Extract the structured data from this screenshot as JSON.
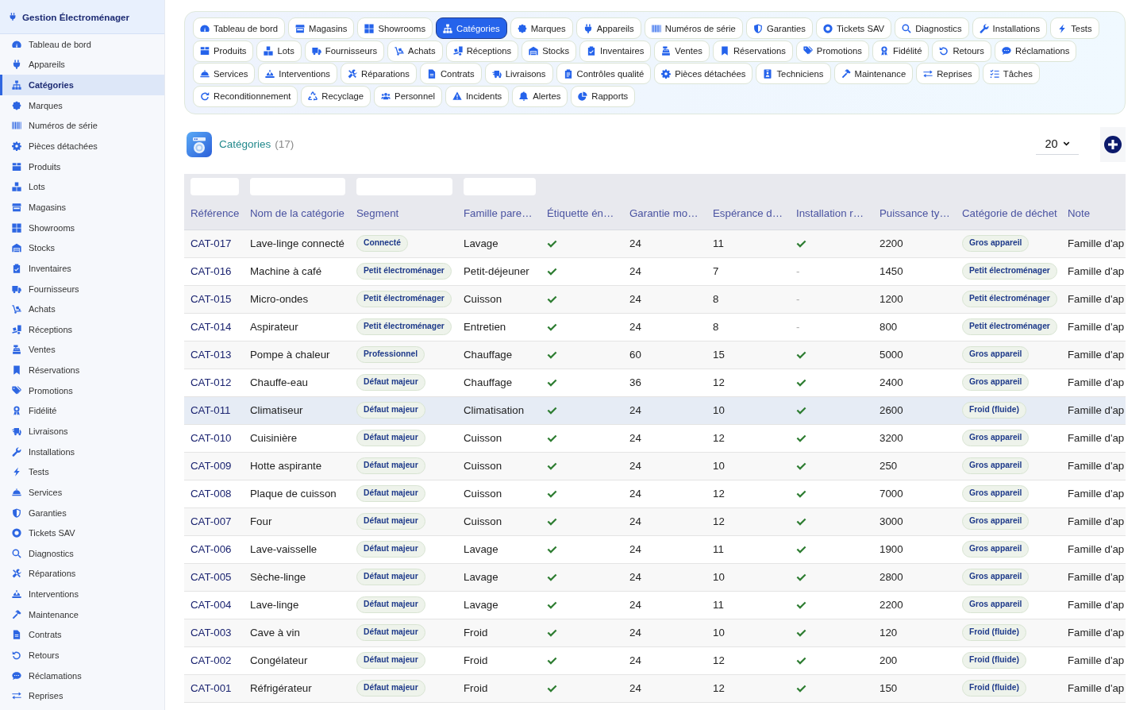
{
  "sidebar": {
    "title": "Gestion Électroménager",
    "items": [
      {
        "label": "Tableau de bord",
        "selected": false
      },
      {
        "label": "Appareils",
        "selected": false
      },
      {
        "label": "Catégories",
        "selected": true
      },
      {
        "label": "Marques",
        "selected": false
      },
      {
        "label": "Numéros de série",
        "selected": false
      },
      {
        "label": "Pièces détachées",
        "selected": false
      },
      {
        "label": "Produits",
        "selected": false
      },
      {
        "label": "Lots",
        "selected": false
      },
      {
        "label": "Magasins",
        "selected": false
      },
      {
        "label": "Showrooms",
        "selected": false
      },
      {
        "label": "Stocks",
        "selected": false
      },
      {
        "label": "Inventaires",
        "selected": false
      },
      {
        "label": "Fournisseurs",
        "selected": false
      },
      {
        "label": "Achats",
        "selected": false
      },
      {
        "label": "Réceptions",
        "selected": false
      },
      {
        "label": "Ventes",
        "selected": false
      },
      {
        "label": "Réservations",
        "selected": false
      },
      {
        "label": "Promotions",
        "selected": false
      },
      {
        "label": "Fidélité",
        "selected": false
      },
      {
        "label": "Livraisons",
        "selected": false
      },
      {
        "label": "Installations",
        "selected": false
      },
      {
        "label": "Tests",
        "selected": false
      },
      {
        "label": "Services",
        "selected": false
      },
      {
        "label": "Garanties",
        "selected": false
      },
      {
        "label": "Tickets SAV",
        "selected": false
      },
      {
        "label": "Diagnostics",
        "selected": false
      },
      {
        "label": "Réparations",
        "selected": false
      },
      {
        "label": "Interventions",
        "selected": false
      },
      {
        "label": "Maintenance",
        "selected": false
      },
      {
        "label": "Contrats",
        "selected": false
      },
      {
        "label": "Retours",
        "selected": false
      },
      {
        "label": "Réclamations",
        "selected": false
      },
      {
        "label": "Reprises",
        "selected": false
      }
    ]
  },
  "tab_rows": [
    [
      {
        "label": "Tableau de bord",
        "selected": false
      },
      {
        "label": "Magasins",
        "selected": false
      },
      {
        "label": "Showrooms",
        "selected": false
      },
      {
        "label": "Catégories",
        "selected": true
      },
      {
        "label": "Marques",
        "selected": false
      },
      {
        "label": "Appareils",
        "selected": false
      },
      {
        "label": "Numéros de série",
        "selected": false
      },
      {
        "label": "Garanties",
        "selected": false
      },
      {
        "label": "Tickets SAV",
        "selected": false
      },
      {
        "label": "Diagnostics",
        "selected": false
      },
      {
        "label": "Installations",
        "selected": false
      },
      {
        "label": "Tests",
        "selected": false
      }
    ],
    [
      {
        "label": "Produits",
        "selected": false
      },
      {
        "label": "Lots",
        "selected": false
      },
      {
        "label": "Fournisseurs",
        "selected": false
      },
      {
        "label": "Achats",
        "selected": false
      },
      {
        "label": "Réceptions",
        "selected": false
      },
      {
        "label": "Stocks",
        "selected": false
      },
      {
        "label": "Inventaires",
        "selected": false
      },
      {
        "label": "Ventes",
        "selected": false
      },
      {
        "label": "Réservations",
        "selected": false
      },
      {
        "label": "Promotions",
        "selected": false
      },
      {
        "label": "Fidélité",
        "selected": false
      },
      {
        "label": "Retours",
        "selected": false
      },
      {
        "label": "Réclamations",
        "selected": false
      }
    ],
    [
      {
        "label": "Services",
        "selected": false
      },
      {
        "label": "Interventions",
        "selected": false
      },
      {
        "label": "Réparations",
        "selected": false
      },
      {
        "label": "Contrats",
        "selected": false
      },
      {
        "label": "Livraisons",
        "selected": false
      },
      {
        "label": "Contrôles qualité",
        "selected": false
      },
      {
        "label": "Pièces détachées",
        "selected": false
      },
      {
        "label": "Techniciens",
        "selected": false
      },
      {
        "label": "Maintenance",
        "selected": false
      },
      {
        "label": "Reprises",
        "selected": false
      },
      {
        "label": "Tâches",
        "selected": false
      }
    ],
    [
      {
        "label": "Reconditionnement",
        "selected": false
      },
      {
        "label": "Recyclage",
        "selected": false
      },
      {
        "label": "Personnel",
        "selected": false
      },
      {
        "label": "Incidents",
        "selected": false
      },
      {
        "label": "Alertes",
        "selected": false
      },
      {
        "label": "Rapports",
        "selected": false
      }
    ]
  ],
  "page_header": {
    "title": "Catégories",
    "count": "(17)",
    "page_size": "20"
  },
  "table": {
    "columns": [
      {
        "label": "Référence",
        "filter": true
      },
      {
        "label": "Nom de la catégorie",
        "filter": true
      },
      {
        "label": "Segment",
        "filter": true
      },
      {
        "label": "Famille pare…",
        "filter": true
      },
      {
        "label": "Étiquette én…",
        "filter": false
      },
      {
        "label": "Garantie mo…",
        "filter": false
      },
      {
        "label": "Espérance d…",
        "filter": false
      },
      {
        "label": "Installation r…",
        "filter": false
      },
      {
        "label": "Puissance ty…",
        "filter": false
      },
      {
        "label": "Catégorie de déchet",
        "filter": false
      },
      {
        "label": "Note",
        "filter": false
      }
    ],
    "rows": [
      {
        "reference": "CAT-017",
        "name": "Lave-linge connecté",
        "segment": "Connecté",
        "family": "Lavage",
        "energy_label": true,
        "warranty": "24",
        "lifespan": "11",
        "installation_required": true,
        "power": "2200",
        "waste_category": "Gros appareil",
        "note": "Famille d'ap",
        "selected": false
      },
      {
        "reference": "CAT-016",
        "name": "Machine à café",
        "segment": "Petit électroménager",
        "family": "Petit-déjeuner",
        "energy_label": true,
        "warranty": "24",
        "lifespan": "7",
        "installation_required": false,
        "empty_mark": "-",
        "power": "1450",
        "waste_category": "Petit électroménager",
        "note": "Famille d'ap",
        "selected": false
      },
      {
        "reference": "CAT-015",
        "name": "Micro-ondes",
        "segment": "Petit électroménager",
        "family": "Cuisson",
        "energy_label": true,
        "warranty": "24",
        "lifespan": "8",
        "installation_required": false,
        "empty_mark": "-",
        "power": "1200",
        "waste_category": "Petit électroménager",
        "note": "Famille d'ap",
        "selected": false
      },
      {
        "reference": "CAT-014",
        "name": "Aspirateur",
        "segment": "Petit électroménager",
        "family": "Entretien",
        "energy_label": true,
        "warranty": "24",
        "lifespan": "8",
        "installation_required": false,
        "empty_mark": "-",
        "power": "800",
        "waste_category": "Petit électroménager",
        "note": "Famille d'ap",
        "selected": false
      },
      {
        "reference": "CAT-013",
        "name": "Pompe à chaleur",
        "segment": "Professionnel",
        "family": "Chauffage",
        "energy_label": true,
        "warranty": "60",
        "lifespan": "15",
        "installation_required": true,
        "power": "5000",
        "waste_category": "Gros appareil",
        "note": "Famille d'ap",
        "selected": false
      },
      {
        "reference": "CAT-012",
        "name": "Chauffe-eau",
        "segment": "Défaut majeur",
        "family": "Chauffage",
        "energy_label": true,
        "warranty": "36",
        "lifespan": "12",
        "installation_required": true,
        "power": "2400",
        "waste_category": "Gros appareil",
        "note": "Famille d'ap",
        "selected": false
      },
      {
        "reference": "CAT-011",
        "name": "Climatiseur",
        "segment": "Défaut majeur",
        "family": "Climatisation",
        "energy_label": true,
        "warranty": "24",
        "lifespan": "10",
        "installation_required": true,
        "power": "2600",
        "waste_category": "Froid (fluide)",
        "note": "Famille d'ap",
        "selected": true
      },
      {
        "reference": "CAT-010",
        "name": "Cuisinière",
        "segment": "Défaut majeur",
        "family": "Cuisson",
        "energy_label": true,
        "warranty": "24",
        "lifespan": "12",
        "installation_required": true,
        "power": "3200",
        "waste_category": "Gros appareil",
        "note": "Famille d'ap",
        "selected": false
      },
      {
        "reference": "CAT-009",
        "name": "Hotte aspirante",
        "segment": "Défaut majeur",
        "family": "Cuisson",
        "energy_label": true,
        "warranty": "24",
        "lifespan": "10",
        "installation_required": true,
        "power": "250",
        "waste_category": "Gros appareil",
        "note": "Famille d'ap",
        "selected": false
      },
      {
        "reference": "CAT-008",
        "name": "Plaque de cuisson",
        "segment": "Défaut majeur",
        "family": "Cuisson",
        "energy_label": true,
        "warranty": "24",
        "lifespan": "12",
        "installation_required": true,
        "power": "7000",
        "waste_category": "Gros appareil",
        "note": "Famille d'ap",
        "selected": false
      },
      {
        "reference": "CAT-007",
        "name": "Four",
        "segment": "Défaut majeur",
        "family": "Cuisson",
        "energy_label": true,
        "warranty": "24",
        "lifespan": "12",
        "installation_required": true,
        "power": "3000",
        "waste_category": "Gros appareil",
        "note": "Famille d'ap",
        "selected": false
      },
      {
        "reference": "CAT-006",
        "name": "Lave-vaisselle",
        "segment": "Défaut majeur",
        "family": "Lavage",
        "energy_label": true,
        "warranty": "24",
        "lifespan": "11",
        "installation_required": true,
        "power": "1900",
        "waste_category": "Gros appareil",
        "note": "Famille d'ap",
        "selected": false
      },
      {
        "reference": "CAT-005",
        "name": "Sèche-linge",
        "segment": "Défaut majeur",
        "family": "Lavage",
        "energy_label": true,
        "warranty": "24",
        "lifespan": "10",
        "installation_required": true,
        "power": "2800",
        "waste_category": "Gros appareil",
        "note": "Famille d'ap",
        "selected": false
      },
      {
        "reference": "CAT-004",
        "name": "Lave-linge",
        "segment": "Défaut majeur",
        "family": "Lavage",
        "energy_label": true,
        "warranty": "24",
        "lifespan": "11",
        "installation_required": true,
        "power": "2200",
        "waste_category": "Gros appareil",
        "note": "Famille d'ap",
        "selected": false
      },
      {
        "reference": "CAT-003",
        "name": "Cave à vin",
        "segment": "Défaut majeur",
        "family": "Froid",
        "energy_label": true,
        "warranty": "24",
        "lifespan": "10",
        "installation_required": true,
        "power": "120",
        "waste_category": "Froid (fluide)",
        "note": "Famille d'ap",
        "selected": false
      },
      {
        "reference": "CAT-002",
        "name": "Congélateur",
        "segment": "Défaut majeur",
        "family": "Froid",
        "energy_label": true,
        "warranty": "24",
        "lifespan": "12",
        "installation_required": true,
        "power": "200",
        "waste_category": "Froid (fluide)",
        "note": "Famille d'ap",
        "selected": false
      },
      {
        "reference": "CAT-001",
        "name": "Réfrigérateur",
        "segment": "Défaut majeur",
        "family": "Froid",
        "energy_label": true,
        "warranty": "24",
        "lifespan": "12",
        "installation_required": true,
        "power": "150",
        "waste_category": "Froid (fluide)",
        "note": "Famille d'ap",
        "selected": false
      }
    ]
  }
}
